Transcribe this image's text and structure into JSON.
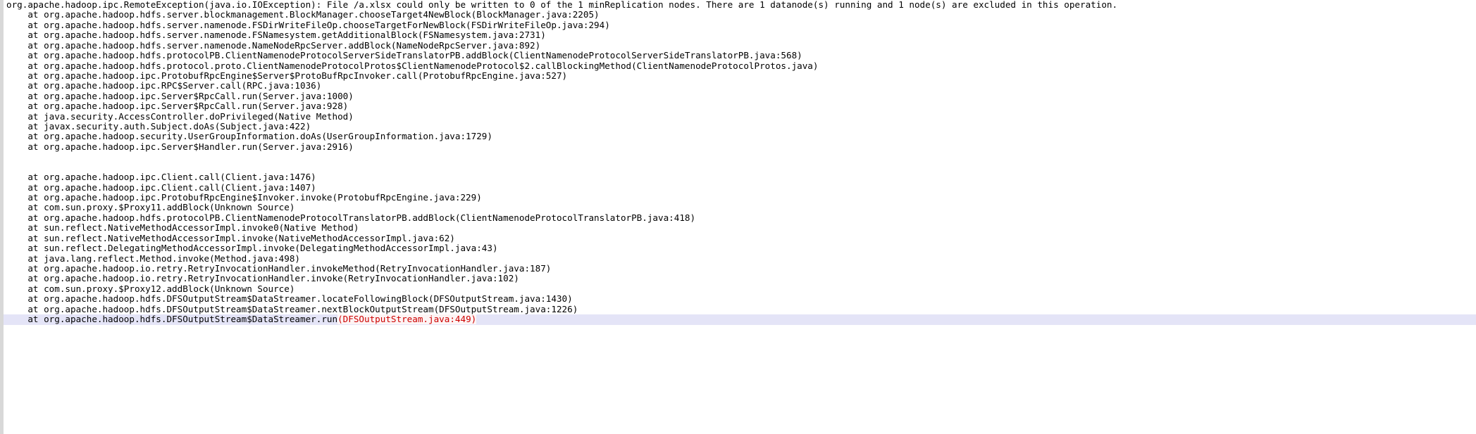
{
  "console": {
    "title": "Hadoop HDFS exception stack trace",
    "highlight_color": "#e4e4f7",
    "link_color": "#cc0000",
    "text_color": "#000000",
    "background_color": "#ffffff",
    "lines": [
      {
        "text": "org.apache.hadoop.ipc.RemoteException(java.io.IOException): File /a.xlsx could only be written to 0 of the 1 minReplication nodes. There are 1 datanode(s) running and 1 node(s) are excluded in this operation."
      },
      {
        "text": "    at org.apache.hadoop.hdfs.server.blockmanagement.BlockManager.chooseTarget4NewBlock(BlockManager.java:2205)"
      },
      {
        "text": "    at org.apache.hadoop.hdfs.server.namenode.FSDirWriteFileOp.chooseTargetForNewBlock(FSDirWriteFileOp.java:294)"
      },
      {
        "text": "    at org.apache.hadoop.hdfs.server.namenode.FSNamesystem.getAdditionalBlock(FSNamesystem.java:2731)"
      },
      {
        "text": "    at org.apache.hadoop.hdfs.server.namenode.NameNodeRpcServer.addBlock(NameNodeRpcServer.java:892)"
      },
      {
        "text": "    at org.apache.hadoop.hdfs.protocolPB.ClientNamenodeProtocolServerSideTranslatorPB.addBlock(ClientNamenodeProtocolServerSideTranslatorPB.java:568)"
      },
      {
        "text": "    at org.apache.hadoop.hdfs.protocol.proto.ClientNamenodeProtocolProtos$ClientNamenodeProtocol$2.callBlockingMethod(ClientNamenodeProtocolProtos.java)"
      },
      {
        "text": "    at org.apache.hadoop.ipc.ProtobufRpcEngine$Server$ProtoBufRpcInvoker.call(ProtobufRpcEngine.java:527)"
      },
      {
        "text": "    at org.apache.hadoop.ipc.RPC$Server.call(RPC.java:1036)"
      },
      {
        "text": "    at org.apache.hadoop.ipc.Server$RpcCall.run(Server.java:1000)"
      },
      {
        "text": "    at org.apache.hadoop.ipc.Server$RpcCall.run(Server.java:928)"
      },
      {
        "text": "    at java.security.AccessController.doPrivileged(Native Method)"
      },
      {
        "text": "    at javax.security.auth.Subject.doAs(Subject.java:422)"
      },
      {
        "text": "    at org.apache.hadoop.security.UserGroupInformation.doAs(UserGroupInformation.java:1729)"
      },
      {
        "text": "    at org.apache.hadoop.ipc.Server$Handler.run(Server.java:2916)"
      },
      {
        "text": ""
      },
      {
        "text": ""
      },
      {
        "text": "    at org.apache.hadoop.ipc.Client.call(Client.java:1476)"
      },
      {
        "text": "    at org.apache.hadoop.ipc.Client.call(Client.java:1407)"
      },
      {
        "text": "    at org.apache.hadoop.ipc.ProtobufRpcEngine$Invoker.invoke(ProtobufRpcEngine.java:229)"
      },
      {
        "text": "    at com.sun.proxy.$Proxy11.addBlock(Unknown Source)"
      },
      {
        "text": "    at org.apache.hadoop.hdfs.protocolPB.ClientNamenodeProtocolTranslatorPB.addBlock(ClientNamenodeProtocolTranslatorPB.java:418)"
      },
      {
        "text": "    at sun.reflect.NativeMethodAccessorImpl.invoke0(Native Method)"
      },
      {
        "text": "    at sun.reflect.NativeMethodAccessorImpl.invoke(NativeMethodAccessorImpl.java:62)"
      },
      {
        "text": "    at sun.reflect.DelegatingMethodAccessorImpl.invoke(DelegatingMethodAccessorImpl.java:43)"
      },
      {
        "text": "    at java.lang.reflect.Method.invoke(Method.java:498)"
      },
      {
        "text": "    at org.apache.hadoop.io.retry.RetryInvocationHandler.invokeMethod(RetryInvocationHandler.java:187)"
      },
      {
        "text": "    at org.apache.hadoop.io.retry.RetryInvocationHandler.invoke(RetryInvocationHandler.java:102)"
      },
      {
        "text": "    at com.sun.proxy.$Proxy12.addBlock(Unknown Source)"
      },
      {
        "text": "    at org.apache.hadoop.hdfs.DFSOutputStream$DataStreamer.locateFollowingBlock(DFSOutputStream.java:1430)"
      },
      {
        "text": "    at org.apache.hadoop.hdfs.DFSOutputStream$DataStreamer.nextBlockOutputStream(DFSOutputStream.java:1226)"
      },
      {
        "text": "    at org.apache.hadoop.hdfs.DFSOutputStream$DataStreamer.run",
        "link": "(DFSOutputStream.java:449)",
        "highlighted": true
      }
    ]
  }
}
